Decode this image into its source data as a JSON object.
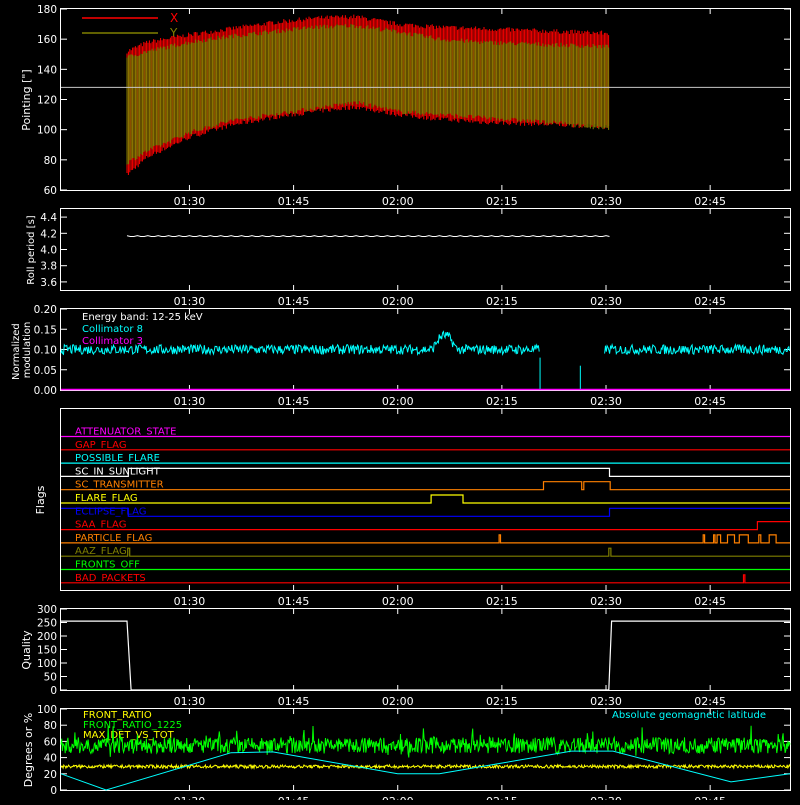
{
  "x_axis": {
    "ticks": [
      "01:30",
      "01:45",
      "02:00",
      "02:15",
      "02:30",
      "02:45"
    ],
    "tick_minutes": [
      90,
      105,
      120,
      135,
      150,
      165
    ],
    "range_minutes": [
      71.5,
      176.5
    ]
  },
  "chart_data": [
    {
      "id": "pointing",
      "type": "line",
      "ylabel": "Pointing [\"]",
      "ylim": [
        60,
        180
      ],
      "yticks": [
        "60",
        "80",
        "100",
        "120",
        "140",
        "160",
        "180"
      ],
      "yticks_values": [
        60,
        80,
        100,
        120,
        140,
        160,
        180
      ],
      "legend": {
        "placement": "top-left",
        "entries": [
          {
            "label": "X",
            "color": "#ff0000"
          },
          {
            "label": "Y",
            "color": "#808000"
          }
        ]
      },
      "reference_line": 128,
      "series": [
        {
          "name": "X",
          "color": "#ff0000",
          "x": [
            81,
            84,
            90,
            96,
            102,
            108,
            114,
            120,
            126,
            132,
            138,
            144,
            150.5
          ],
          "upper": [
            152,
            158,
            163,
            167,
            171,
            174,
            175,
            170,
            168,
            167,
            166,
            165,
            164
          ],
          "lower": [
            70,
            82,
            95,
            103,
            108,
            112,
            115,
            110,
            107,
            105,
            104,
            103,
            102
          ]
        },
        {
          "name": "Y",
          "color": "#808000",
          "x": [
            81,
            84,
            90,
            96,
            102,
            108,
            114,
            120,
            126,
            132,
            138,
            144,
            150.5
          ],
          "upper": [
            148,
            152,
            158,
            162,
            165,
            168,
            169,
            165,
            160,
            158,
            157,
            156,
            155
          ],
          "lower": [
            78,
            86,
            98,
            106,
            110,
            114,
            118,
            112,
            110,
            108,
            106,
            104,
            100
          ]
        }
      ]
    },
    {
      "id": "roll-period",
      "type": "line",
      "ylabel": "Roll period [s]",
      "ylim": [
        3.5,
        4.5
      ],
      "yticks": [
        "3.6",
        "3.8",
        "4.0",
        "4.2",
        "4.4"
      ],
      "yticks_values": [
        3.6,
        3.8,
        4.0,
        4.2,
        4.4
      ],
      "series": [
        {
          "color": "#ffffff",
          "x": [
            81,
            150.5
          ],
          "y": [
            4.16,
            4.16
          ]
        }
      ]
    },
    {
      "id": "modulation",
      "type": "line",
      "ylabel": "Normalized modulation",
      "ylim": [
        0.0,
        0.2
      ],
      "yticks": [
        "0.00",
        "0.05",
        "0.10",
        "0.15",
        "0.20"
      ],
      "yticks_values": [
        0.0,
        0.05,
        0.1,
        0.15,
        0.2
      ],
      "annotation": "Energy band: 12-25 keV",
      "legend": {
        "placement": "top-left",
        "entries": [
          {
            "label": "Collimator 8",
            "color": "#00ffff"
          },
          {
            "label": "Collimator 3",
            "color": "#ff00ff"
          }
        ]
      },
      "series": [
        {
          "name": "Collimator 8",
          "color": "#00ffff",
          "level": 0.1,
          "spread": 0.012,
          "segments": [
            [
              71.5,
              140.5
            ],
            [
              149.8,
              176.5
            ]
          ],
          "bump": {
            "x": [
              125,
              128.5
            ],
            "y": 0.135
          }
        },
        {
          "name": "Collimator 3",
          "color": "#ff00ff",
          "x": [
            71.5,
            176.5
          ],
          "y": [
            0.0,
            0.0
          ]
        }
      ]
    },
    {
      "id": "flags",
      "type": "line",
      "ylabel": "Flags",
      "series": [
        {
          "name": "ATTENUATOR_STATE",
          "color": "#ff00ff",
          "steps": [
            [
              71.5,
              0
            ],
            [
              176.5,
              0
            ]
          ]
        },
        {
          "name": "GAP_FLAG",
          "color": "#ff0000",
          "steps": [
            [
              71.5,
              0
            ],
            [
              176.5,
              0
            ]
          ]
        },
        {
          "name": "POSSIBLE_FLARE",
          "color": "#00ffff",
          "steps": [
            [
              71.5,
              0
            ],
            [
              176.5,
              0
            ]
          ]
        },
        {
          "name": "SC_IN_SUNLIGHT",
          "color": "#ffffff",
          "steps": [
            [
              71.5,
              0
            ],
            [
              81.2,
              1
            ],
            [
              150.5,
              0
            ],
            [
              176.5,
              0
            ]
          ]
        },
        {
          "name": "SC_TRANSMITTER",
          "color": "#ff8000",
          "steps": [
            [
              71.5,
              0
            ],
            [
              141,
              1
            ],
            [
              146.5,
              0
            ],
            [
              146.8,
              1
            ],
            [
              150.6,
              0
            ],
            [
              176.5,
              0
            ]
          ]
        },
        {
          "name": "FLARE_FLAG",
          "color": "#ffff00",
          "steps": [
            [
              71.5,
              0
            ],
            [
              124.8,
              1
            ],
            [
              129.4,
              0
            ],
            [
              176.5,
              0
            ]
          ]
        },
        {
          "name": "ECLIPSE_FLAG",
          "color": "#0000ff",
          "steps": [
            [
              71.5,
              1
            ],
            [
              81.2,
              0
            ],
            [
              150.5,
              1
            ],
            [
              176.5,
              1
            ]
          ]
        },
        {
          "name": "SAA_FLAG",
          "color": "#ff0000",
          "steps": [
            [
              71.5,
              0
            ],
            [
              171.8,
              1
            ],
            [
              176.5,
              1
            ]
          ]
        },
        {
          "name": "PARTICLE_FLAG",
          "color": "#ff8000",
          "steps": [
            [
              71.5,
              0
            ],
            [
              134.6,
              1
            ],
            [
              134.8,
              0
            ],
            [
              164,
              1
            ],
            [
              164.2,
              0
            ],
            [
              165.5,
              1
            ],
            [
              165.7,
              0
            ],
            [
              166,
              1
            ],
            [
              166.5,
              0
            ],
            [
              167.5,
              1
            ],
            [
              168.5,
              0
            ],
            [
              169.2,
              1
            ],
            [
              170.5,
              0
            ],
            [
              172,
              1
            ],
            [
              172.3,
              0
            ],
            [
              173.5,
              1
            ],
            [
              174.5,
              0
            ],
            [
              176.5,
              0
            ]
          ]
        },
        {
          "name": "AAZ_FLAG",
          "color": "#808000",
          "steps": [
            [
              71.5,
              0
            ],
            [
              81.1,
              1
            ],
            [
              81.4,
              0
            ],
            [
              150.4,
              1
            ],
            [
              150.7,
              0
            ],
            [
              176.5,
              0
            ]
          ]
        },
        {
          "name": "FRONTS_OFF",
          "color": "#00ff00",
          "steps": [
            [
              71.5,
              0
            ],
            [
              176.5,
              0
            ]
          ]
        },
        {
          "name": "BAD_PACKETS",
          "color": "#ff0000",
          "steps": [
            [
              71.5,
              0
            ],
            [
              169.8,
              1
            ],
            [
              170,
              0
            ],
            [
              176.5,
              0
            ]
          ]
        }
      ]
    },
    {
      "id": "quality",
      "type": "line",
      "ylabel": "Quality",
      "ylim": [
        0,
        300
      ],
      "yticks": [
        "0",
        "50",
        "100",
        "150",
        "200",
        "250",
        "300"
      ],
      "yticks_values": [
        0,
        50,
        100,
        150,
        200,
        250,
        300
      ],
      "series": [
        {
          "color": "#ffffff",
          "x": [
            71.5,
            81.0,
            81.6,
            150.4,
            150.8,
            176.5
          ],
          "y": [
            255,
            255,
            0,
            0,
            255,
            255
          ]
        }
      ]
    },
    {
      "id": "degrees",
      "type": "line",
      "ylabel": "Degrees or %",
      "ylim": [
        0,
        100
      ],
      "yticks": [
        "0",
        "20",
        "40",
        "60",
        "80",
        "100"
      ],
      "yticks_values": [
        0,
        20,
        40,
        60,
        80,
        100
      ],
      "legend": {
        "placement": "top-left",
        "entries": [
          {
            "label": "FRONT_RATIO",
            "color": "#ffff00"
          },
          {
            "label": "FRONT_RATIO_1225",
            "color": "#00ff00"
          },
          {
            "label": "MAX_DET_VS_TOT",
            "color": "#ffff00"
          }
        ]
      },
      "annotation": "Absolute geomagnetic latitude",
      "annotation_color": "#00ffff",
      "series": [
        {
          "name": "FRONT_RATIO_1225",
          "color": "#00ff00",
          "level": 55,
          "spread": 10
        },
        {
          "name": "FRONT_RATIO",
          "color": "#ffff00",
          "level": 29,
          "spread": 2
        },
        {
          "name": "Absolute geomagnetic latitude",
          "color": "#00ffff",
          "x": [
            71.5,
            78,
            96,
            102,
            120,
            126,
            145,
            151,
            168,
            176.5
          ],
          "y": [
            20,
            0,
            46,
            47,
            20,
            20,
            48,
            48,
            10,
            20
          ]
        }
      ]
    }
  ]
}
